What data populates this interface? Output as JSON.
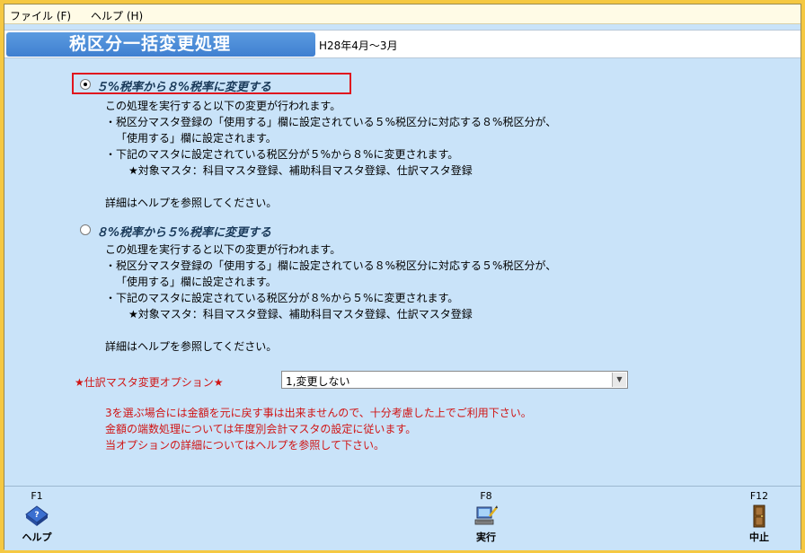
{
  "menu": {
    "file": "ファイル (F)",
    "help": "ヘルプ (H)"
  },
  "title": {
    "text": "税区分一括変更処理",
    "period": "H28年4月～3月"
  },
  "option1": {
    "label": "５%税率から８%税率に変更する",
    "checked": true,
    "lines": [
      "この処理を実行すると以下の変更が行われます。",
      "・税区分マスタ登録の「使用する」欄に設定されている５%税区分に対応する８%税区分が、",
      "「使用する」欄に設定されます。",
      "・下記のマスタに設定されている税区分が５%から８%に変更されます。",
      "★対象マスタ：科目マスタ登録、補助科目マスタ登録、仕訳マスタ登録",
      "詳細はヘルプを参照してください。"
    ]
  },
  "option2": {
    "label": "８%税率から５%税率に変更する",
    "checked": false,
    "lines": [
      "この処理を実行すると以下の変更が行われます。",
      "・税区分マスタ登録の「使用する」欄に設定されている８%税区分に対応する５%税区分が、",
      "「使用する」欄に設定されます。",
      "・下記のマスタに設定されている税区分が８%から５%に変更されます。",
      "★対象マスタ：科目マスタ登録、補助科目マスタ登録、仕訳マスタ登録",
      "詳細はヘルプを参照してください。"
    ]
  },
  "journal_option": {
    "label": "★仕訳マスタ変更オプション★",
    "selected": "1,変更しない"
  },
  "notes": [
    "3を選ぶ場合には金額を元に戻す事は出来ませんので、十分考慮した上でご利用下さい。",
    "金額の端数処理については年度別会計マスタの設定に従います。",
    "当オプションの詳細についてはヘルプを参照して下さい。"
  ],
  "footer": {
    "f1_key": "F1",
    "f1_label": "ヘルプ",
    "f8_key": "F8",
    "f8_label": "実行",
    "f12_key": "F12",
    "f12_label": "中止"
  },
  "colors": {
    "background": "#c9e3f9",
    "title_panel": "#4a8ad8",
    "accent_red": "#d01414",
    "frame": "#f5c842"
  }
}
